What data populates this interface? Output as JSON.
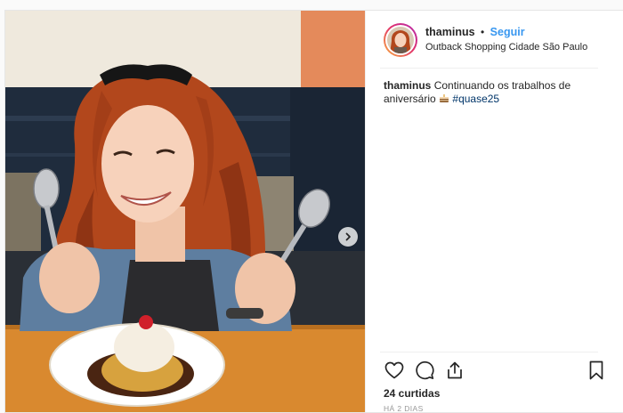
{
  "post": {
    "username": "thaminus",
    "bullet": "•",
    "follow_label": "Seguir",
    "location": "Outback Shopping Cidade São Paulo",
    "caption": {
      "username": "thaminus",
      "text": "Continuando os trabalhos de aniversário",
      "emoji": "cake-icon",
      "hashtag": "#quase25"
    },
    "likes": "24 curtidas",
    "time": "HÁ 2 DIAS"
  },
  "icons": {
    "next": "chevron-right-icon",
    "like": "heart-icon",
    "comment": "comment-icon",
    "share": "share-icon",
    "save": "bookmark-icon"
  },
  "colors": {
    "follow": "#3897f0",
    "hashtag": "#003569",
    "text": "#262626",
    "muted": "#999999",
    "hair": "#b2471c",
    "wall_orange": "#e48a5b",
    "booth_navy": "#1f2c3d",
    "table_wood": "#d9892f"
  }
}
